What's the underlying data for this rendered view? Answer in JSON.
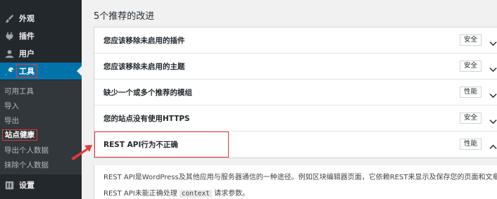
{
  "sidebar": {
    "items": [
      {
        "label": "外观",
        "icon": "paintbrush-icon"
      },
      {
        "label": "插件",
        "icon": "plugin-icon"
      },
      {
        "label": "用户",
        "icon": "user-icon"
      },
      {
        "label": "工具",
        "icon": "wrench-icon"
      },
      {
        "label": "设置",
        "icon": "settings-icon"
      }
    ],
    "submenu": [
      "可用工具",
      "导入",
      "导出",
      "站点健康",
      "导出个人数据",
      "抹除个人数据"
    ]
  },
  "main": {
    "section_title": "5个推荐的改进",
    "issues": [
      {
        "title": "您应该移除未启用的插件",
        "badge": "安全"
      },
      {
        "title": "您应该移除未启用的主题",
        "badge": "安全"
      },
      {
        "title": "缺少一个或多个推荐的模组",
        "badge": "性能"
      },
      {
        "title": "您的站点没有使用HTTPS",
        "badge": "安全"
      },
      {
        "title": "REST API行为不正确",
        "badge": "性能"
      }
    ],
    "detail": {
      "line1": "REST API是WordPress及其他应用与服务器通信的一种途径。例如区块编辑器页面，它依赖REST来显示及保存您的页面和文章。",
      "line2_pre": "REST API未能正确处理",
      "line2_code": "context",
      "line2_post": "请求参数。"
    }
  },
  "colors": {
    "sidebar_bg": "#23282d",
    "active_bg": "#0073aa",
    "highlight": "#e23a3a"
  }
}
